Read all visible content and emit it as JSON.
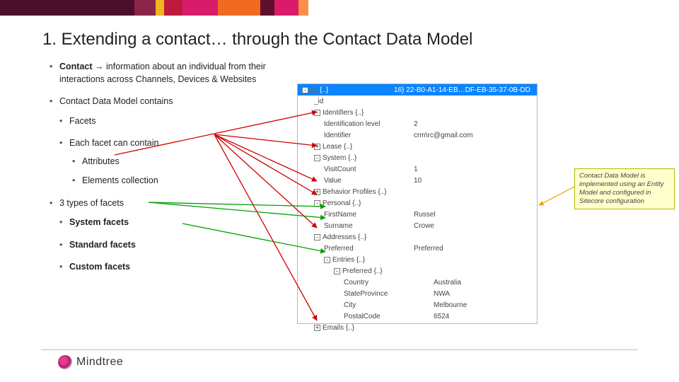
{
  "title": "1. Extending a contact… through the Contact Data Model",
  "bullets": {
    "contact_label": "Contact",
    "arrow_glyph": "→",
    "contact_rest": " information about an individual from their interactions across Channels, Devices & Websites",
    "cdm_label": "Contact Data Model contains",
    "facets": "Facets",
    "each_facet": "Each facet can contain",
    "attributes": "Attributes",
    "elements": "Elements collection",
    "types_facets": "3 types of facets",
    "system_facets": "System facets",
    "standard_facets": "Standard facets",
    "custom_facets": "Custom facets"
  },
  "note": "Contact Data Model is implemented using an Entity Model and configured in Sitecore configuration",
  "logo_text": "Mindtree",
  "tree": {
    "root_label": "{..}",
    "root_val": "16} 22-B0-A1-14-EB…DF-EB-35-37-0B-DD",
    "rows": [
      {
        "depth": 2,
        "label": "_id",
        "val": ""
      },
      {
        "depth": 2,
        "box": "-",
        "label": "Identifiers {..}",
        "val": ""
      },
      {
        "depth": 3,
        "label": "Identification level",
        "val": "2"
      },
      {
        "depth": 3,
        "label": "Identifier",
        "val": "crm\\rc@gmail.com"
      },
      {
        "depth": 2,
        "box": "+",
        "label": "Lease {..}",
        "val": ""
      },
      {
        "depth": 2,
        "box": "-",
        "label": "System {..}",
        "val": ""
      },
      {
        "depth": 3,
        "label": "VisitCount",
        "val": "1"
      },
      {
        "depth": 3,
        "label": "Value",
        "val": "10"
      },
      {
        "depth": 2,
        "box": "+",
        "label": "Behavior Profiles {..}",
        "val": ""
      },
      {
        "depth": 2,
        "box": "-",
        "label": "Personal {..}",
        "val": ""
      },
      {
        "depth": 3,
        "label": "FirstName",
        "val": "Russel"
      },
      {
        "depth": 3,
        "label": "Surname",
        "val": "Crowe"
      },
      {
        "depth": 2,
        "box": "-",
        "label": "Addresses {..}",
        "val": ""
      },
      {
        "depth": 3,
        "label": "Preferred",
        "val": "Preferred"
      },
      {
        "depth": 3,
        "box": "-",
        "label": "Entries {..}",
        "val": ""
      },
      {
        "depth": 4,
        "box": "-",
        "label": "Preferred {..}",
        "val": ""
      },
      {
        "depth": 5,
        "label": "Country",
        "val": "Australia"
      },
      {
        "depth": 5,
        "label": "StateProvince",
        "val": "NWA"
      },
      {
        "depth": 5,
        "label": "City",
        "val": "Melbourne"
      },
      {
        "depth": 5,
        "label": "PostalCode",
        "val": "6524"
      },
      {
        "depth": 2,
        "box": "+",
        "label": "Emails {..}",
        "val": ""
      }
    ]
  }
}
